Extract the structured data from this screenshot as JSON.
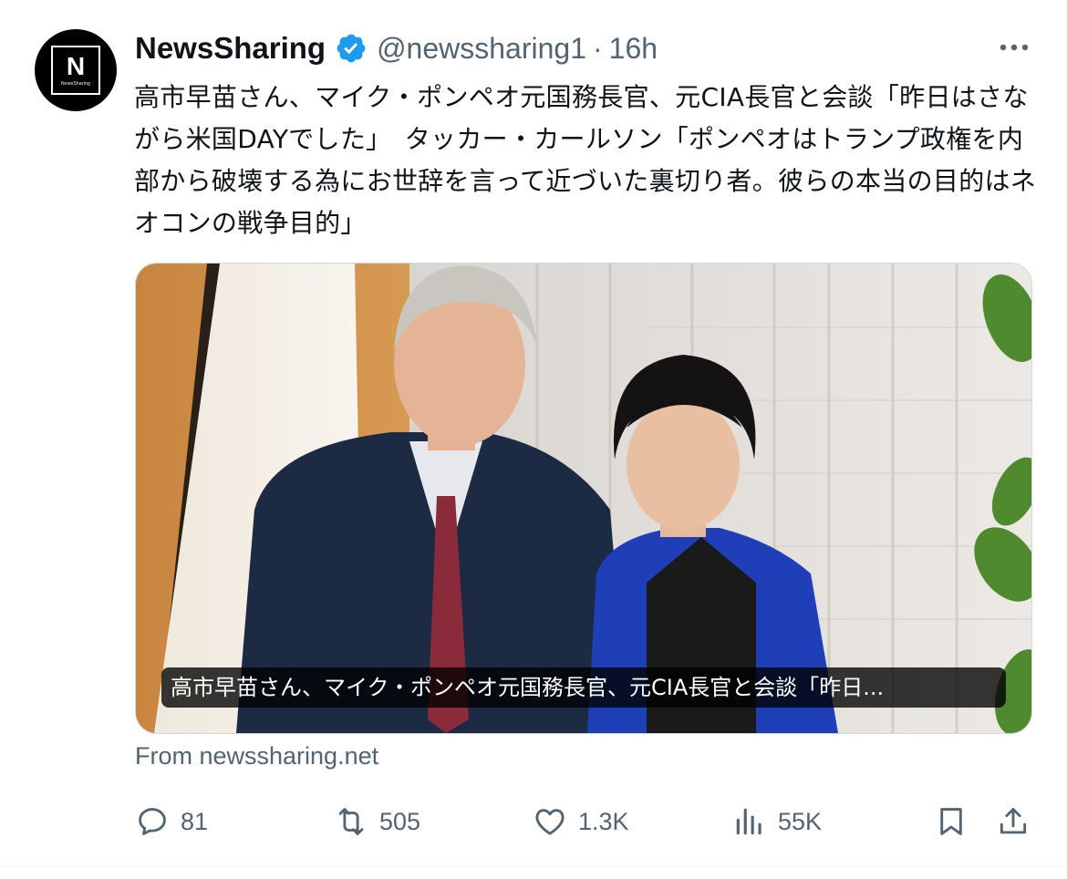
{
  "author": {
    "avatar_letter": "N",
    "avatar_caption": "NewsSharing",
    "display_name": "NewsSharing",
    "handle": "@newssharing1",
    "separator": "·",
    "time": "16h"
  },
  "tweet": {
    "text": "高市早苗さん、マイク・ポンペオ元国務長官、元CIA長官と会談「昨日はさながら米国DAYでした」　タッカー・カールソン「ポンペオはトランプ政権を内部から破壊する為にお世辞を言って近づいた裏切り者。彼らの本当の目的はネオコンの戦争目的」"
  },
  "media": {
    "caption": "高市早苗さん、マイク・ポンペオ元国務長官、元CIA長官と会談「昨日..."
  },
  "source": {
    "text": "From newssharing.net"
  },
  "actions": {
    "replies": "81",
    "reposts": "505",
    "likes": "1.3K",
    "views": "55K"
  },
  "icons": {
    "verified": "verified-badge-icon",
    "more": "more-icon",
    "reply": "reply-icon",
    "repost": "repost-icon",
    "like": "like-icon",
    "views": "views-icon",
    "bookmark": "bookmark-icon",
    "share": "share-icon"
  },
  "colors": {
    "verified_blue": "#1d9bf0",
    "text_primary": "#0f1419",
    "text_secondary": "#536471"
  }
}
